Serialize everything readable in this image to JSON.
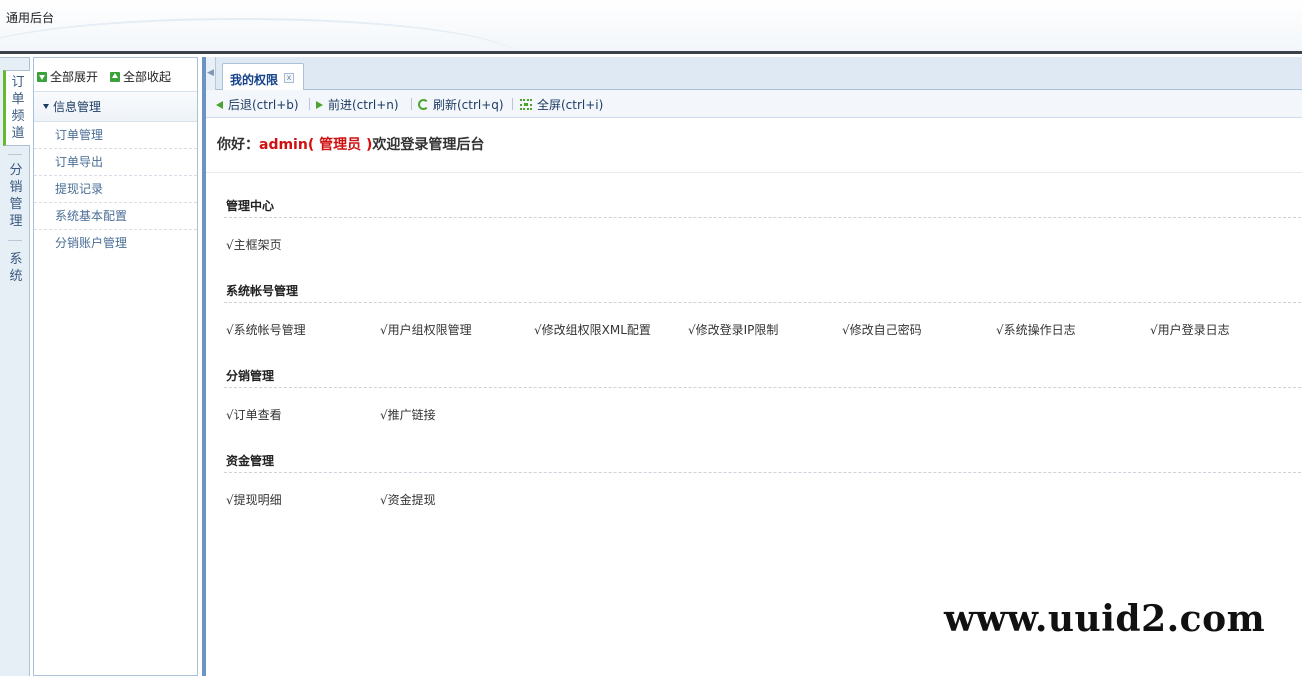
{
  "header": {
    "title": "通用后台"
  },
  "channels": [
    {
      "label": "订单频道",
      "active": true
    },
    {
      "label": "分销管理",
      "active": false
    },
    {
      "label": "系统",
      "active": false
    }
  ],
  "sidebar": {
    "expand_all": "全部展开",
    "collapse_all": "全部收起",
    "group": "信息管理",
    "items": [
      "订单管理",
      "订单导出",
      "提现记录",
      "系统基本配置",
      "分销账户管理"
    ]
  },
  "tabs": [
    {
      "label": "我的权限",
      "close_glyph": "x"
    }
  ],
  "toolbar": {
    "back": "后退(ctrl+b)",
    "forward": "前进(ctrl+n)",
    "refresh": "刷新(ctrl+q)",
    "fullscreen": "全屏(ctrl+i)"
  },
  "welcome": {
    "greeting": "你好：",
    "user": "admin( 管理员 )",
    "message": "欢迎登录管理后台"
  },
  "sections": [
    {
      "title": "管理中心",
      "items": [
        "√主框架页"
      ]
    },
    {
      "title": "系统帐号管理",
      "items": [
        "√系统帐号管理",
        "√用户组权限管理",
        "√修改组权限XML配置",
        "√修改登录IP限制",
        "√修改自己密码",
        "√系统操作日志",
        "√用户登录日志"
      ]
    },
    {
      "title": "分销管理",
      "items": [
        "√订单查看",
        "√推广链接"
      ]
    },
    {
      "title": "资金管理",
      "items": [
        "√提现明细",
        "√资金提现"
      ]
    }
  ],
  "watermark": "www.uuid2.com",
  "colors": {
    "accent_green": "#4aa52e",
    "nav_blue": "#15428b",
    "admin_red": "#d01010"
  }
}
